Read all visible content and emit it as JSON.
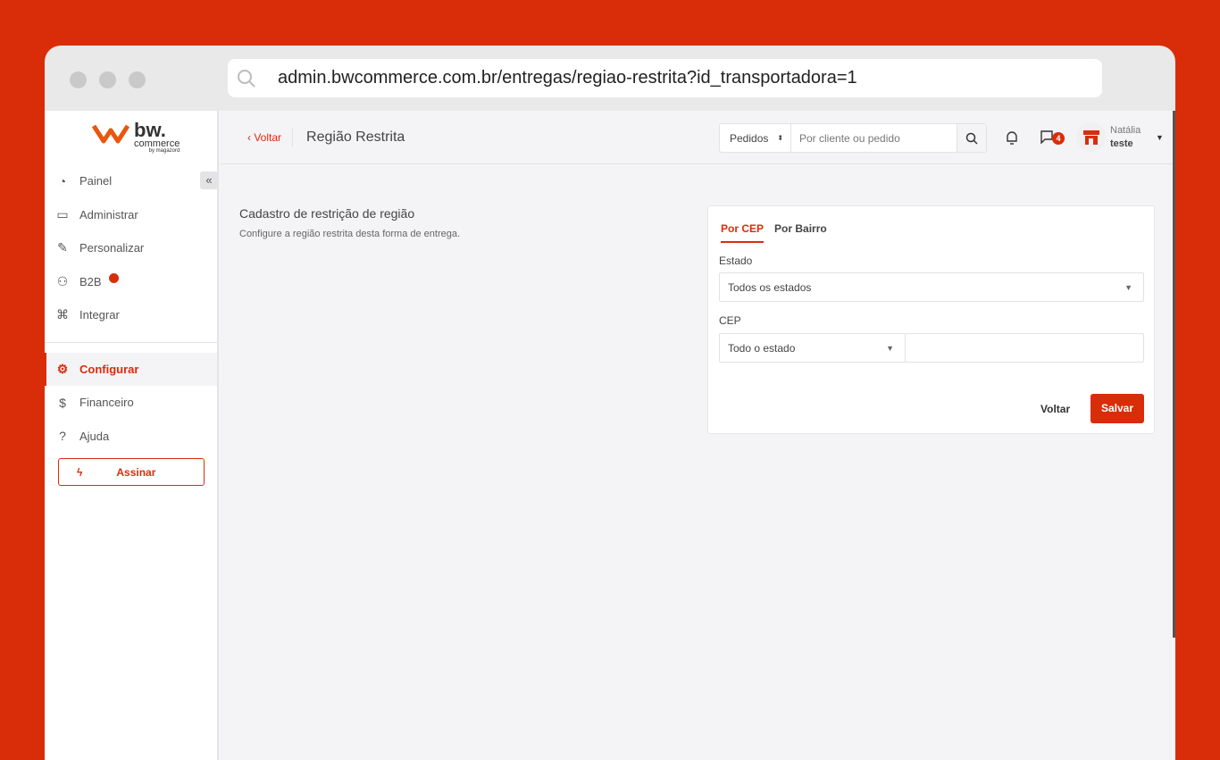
{
  "browser": {
    "url": "admin.bwcommerce.com.br/entregas/regiao-restrita?id_transportadora=1"
  },
  "logo": {
    "brand": "bw.",
    "sub": "commerce",
    "by": "by magazord"
  },
  "sidebar": {
    "items": [
      {
        "label": "Painel",
        "icon": "◔"
      },
      {
        "label": "Administrar",
        "icon": "▭"
      },
      {
        "label": "Personalizar",
        "icon": "✎"
      },
      {
        "label": "B2B",
        "icon": "⚇"
      },
      {
        "label": "Integrar",
        "icon": "⌘"
      }
    ],
    "items2": [
      {
        "label": "Configurar",
        "icon": "⚙"
      },
      {
        "label": "Financeiro",
        "icon": "$"
      },
      {
        "label": "Ajuda",
        "icon": "?"
      }
    ],
    "cta": "Assinar",
    "collapse": "«"
  },
  "header": {
    "back": "Voltar",
    "title": "Região Restrita",
    "search_scope": "Pedidos",
    "search_placeholder": "Por cliente ou pedido",
    "chat_count": "4",
    "user_name": "Natália",
    "user_store": "teste"
  },
  "main": {
    "heading": "Cadastro de restrição de região",
    "description": "Configure a região restrita desta forma de entrega.",
    "tabs": [
      "Por CEP",
      "Por Bairro"
    ],
    "estado_label": "Estado",
    "estado_value": "Todos os estados",
    "cep_label": "CEP",
    "cep_mode": "Todo o estado",
    "cep_value": "",
    "cancel": "Voltar",
    "save": "Salvar"
  },
  "colors": {
    "accent": "#d92d0a"
  }
}
